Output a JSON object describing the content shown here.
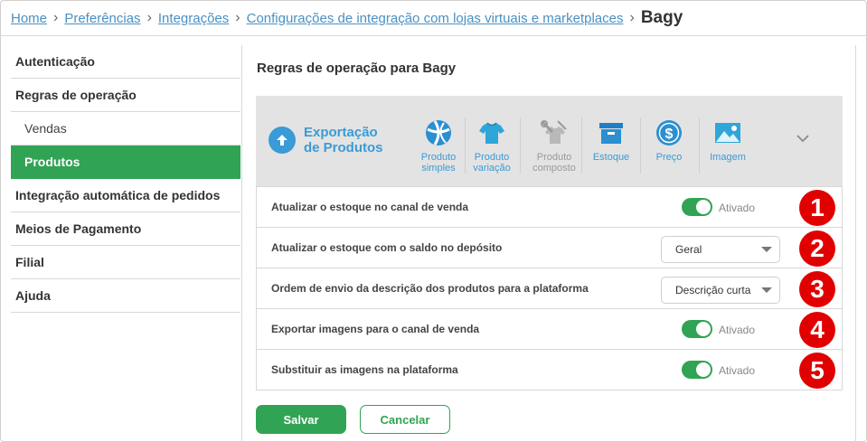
{
  "breadcrumb": {
    "items": [
      "Home",
      "Preferências",
      "Integrações",
      "Configurações de integração com lojas virtuais e marketplaces"
    ],
    "current": "Bagy"
  },
  "sidebar": {
    "items": [
      {
        "label": "Autenticação"
      },
      {
        "label": "Regras de operação"
      },
      {
        "label": "Vendas"
      },
      {
        "label": "Produtos"
      },
      {
        "label": "Integração automática de pedidos"
      },
      {
        "label": "Meios de Pagamento"
      },
      {
        "label": "Filial"
      },
      {
        "label": "Ajuda"
      }
    ],
    "active_item": "Produtos"
  },
  "main": {
    "title": "Regras de operação para Bagy",
    "export": {
      "label_line1": "Exportação",
      "label_line2": "de Produtos",
      "icon": "arrow-up-circle-icon",
      "tiles": [
        {
          "line1": "Produto",
          "line2": "simples",
          "icon": "ball-icon",
          "enabled": true
        },
        {
          "line1": "Produto",
          "line2": "variação",
          "icon": "tshirt-icon",
          "enabled": true
        },
        {
          "line1": "Produto",
          "line2": "composto",
          "icon": "tools-tshirt-icon",
          "enabled": false
        },
        {
          "line1": "Estoque",
          "line2": "",
          "icon": "box-icon",
          "enabled": true
        },
        {
          "line1": "Preço",
          "line2": "",
          "icon": "dollar-icon",
          "enabled": true
        },
        {
          "line1": "Imagem",
          "line2": "",
          "icon": "image-icon",
          "enabled": true
        }
      ]
    },
    "settings": [
      {
        "label": "Atualizar o estoque no canal de venda",
        "control": "toggle",
        "value": "Ativado",
        "badge": "1"
      },
      {
        "label": "Atualizar o estoque com o saldo no depósito",
        "control": "select",
        "value": "Geral",
        "badge": "2"
      },
      {
        "label": "Ordem de envio da descrição dos produtos para a plataforma",
        "control": "select",
        "value": "Descrição curta p",
        "badge": "3"
      },
      {
        "label": "Exportar imagens para o canal de venda",
        "control": "toggle",
        "value": "Ativado",
        "badge": "4"
      },
      {
        "label": "Substituir as imagens na plataforma",
        "control": "toggle",
        "value": "Ativado",
        "badge": "5"
      }
    ],
    "buttons": {
      "save": "Salvar",
      "cancel": "Cancelar"
    }
  },
  "colors": {
    "accent": "#31a354",
    "link": "#4a90c2",
    "export_blue": "#3a9bd6",
    "badge_red": "#e10000"
  }
}
